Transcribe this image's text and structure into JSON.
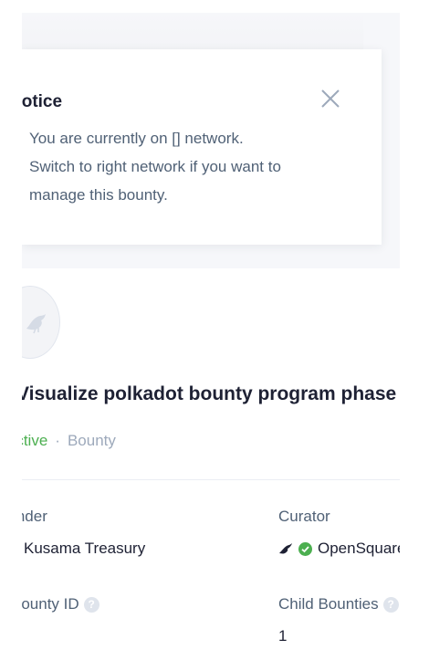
{
  "notice": {
    "title": "Notice",
    "lines": [
      "You are currently on [] network.",
      "Switch to right network if you want to",
      "manage this bounty."
    ]
  },
  "bounty": {
    "title": "Visualize polkadot bounty program phase",
    "status": "Active",
    "type": "Bounty"
  },
  "info": {
    "funder_label": "Funder",
    "funder_value": "Kusama Treasury",
    "curator_label": "Curator",
    "curator_value": "OpenSquare",
    "bounty_id_label": "Bounty ID",
    "child_bounties_label": "Child Bounties",
    "child_bounties_value": "1"
  },
  "icons": {
    "close": "close-icon",
    "avatar": "kusama-bird-icon",
    "help": "question-icon",
    "verified": "verified-check-icon"
  },
  "colors": {
    "accent_green": "#4caf50",
    "text_primary": "#1e2134",
    "text_secondary": "#506176",
    "text_muted": "#9da9bb"
  }
}
